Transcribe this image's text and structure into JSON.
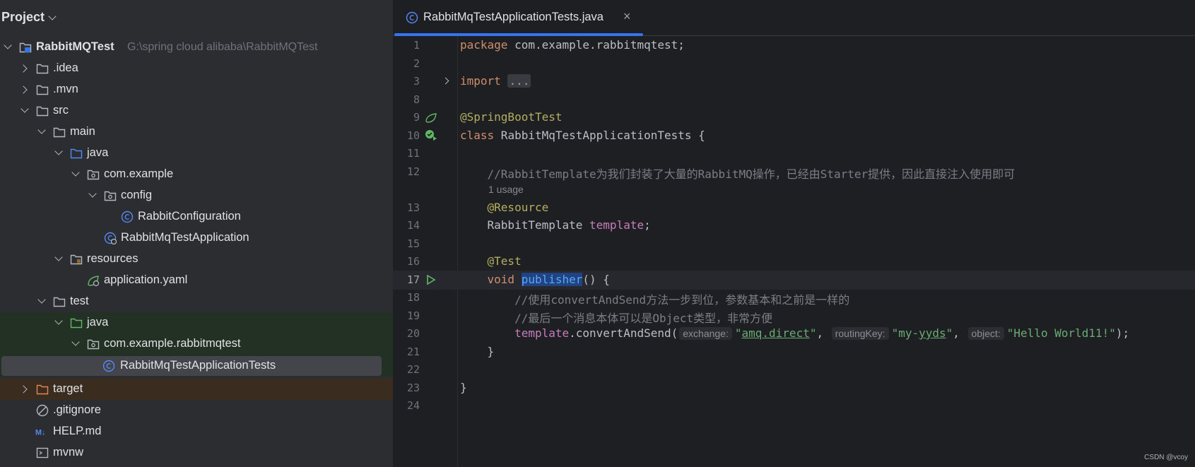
{
  "project": {
    "title": "Project",
    "tree": [
      {
        "label": "RabbitMQTest",
        "path": "G:\\spring cloud alibaba\\RabbitMQTest"
      },
      {
        "label": ".idea"
      },
      {
        "label": ".mvn"
      },
      {
        "label": "src"
      },
      {
        "label": "main"
      },
      {
        "label": "java"
      },
      {
        "label": "com.example"
      },
      {
        "label": "config"
      },
      {
        "label": "RabbitConfiguration"
      },
      {
        "label": "RabbitMqTestApplication"
      },
      {
        "label": "resources"
      },
      {
        "label": "application.yaml"
      },
      {
        "label": "test"
      },
      {
        "label": "java"
      },
      {
        "label": "com.example.rabbitmqtest"
      },
      {
        "label": "RabbitMqTestApplicationTests"
      },
      {
        "label": "target"
      },
      {
        "label": ".gitignore"
      },
      {
        "label": "HELP.md"
      },
      {
        "label": "mvnw"
      }
    ]
  },
  "editor": {
    "tab": {
      "label": "RabbitMqTestApplicationTests.java",
      "close": "×"
    },
    "usage_hint": "1 usage",
    "lines": [
      {
        "num": "1",
        "tokens": [
          "package",
          " com.example.rabbitmqtest;"
        ]
      },
      {
        "num": "2"
      },
      {
        "num": "3",
        "tokens": [
          "import",
          " ",
          "..."
        ]
      },
      {
        "num": "8"
      },
      {
        "num": "9",
        "tokens": [
          "@SpringBootTest"
        ]
      },
      {
        "num": "10",
        "tokens": [
          "class",
          " RabbitMqTestApplicationTests {"
        ]
      },
      {
        "num": "11"
      },
      {
        "num": "12",
        "tokens": [
          "    //RabbitTemplate为我们封装了大量的RabbitMQ操作，已经由Starter提供，因此直接注入使用即可"
        ]
      },
      {
        "num": "13",
        "tokens": [
          "    ",
          "@Resource"
        ]
      },
      {
        "num": "14",
        "tokens": [
          "    RabbitTemplate ",
          "template",
          ";"
        ]
      },
      {
        "num": "15"
      },
      {
        "num": "16",
        "tokens": [
          "    ",
          "@Test"
        ]
      },
      {
        "num": "17",
        "tokens": [
          "    ",
          "void",
          " ",
          "publisher",
          "() {"
        ]
      },
      {
        "num": "18",
        "tokens": [
          "        //使用convertAndSend方法一步到位，参数基本和之前是一样的"
        ]
      },
      {
        "num": "19",
        "tokens": [
          "        //最后一个消息本体可以是Object类型，非常方便"
        ]
      },
      {
        "num": "20",
        "tokens": [
          "        ",
          "template",
          ".convertAndSend(",
          "exchange:",
          "\"",
          "amq.direct",
          "\"",
          ", ",
          "routingKey:",
          "\"my-",
          "yyds",
          "\"",
          ", ",
          "object:",
          "\"Hello World11!\"",
          ");"
        ]
      },
      {
        "num": "21",
        "tokens": [
          "    }"
        ]
      },
      {
        "num": "22"
      },
      {
        "num": "23",
        "tokens": [
          "}"
        ]
      },
      {
        "num": "24"
      }
    ]
  },
  "watermark": "CSDN @vcoy",
  "colors": {
    "accent": "#3574f0",
    "keyword": "#cf8e6d",
    "annotation": "#b3ae60",
    "string": "#6aab73",
    "field": "#c77dbb",
    "method": "#56a8f5",
    "comment": "#7a7e85"
  }
}
